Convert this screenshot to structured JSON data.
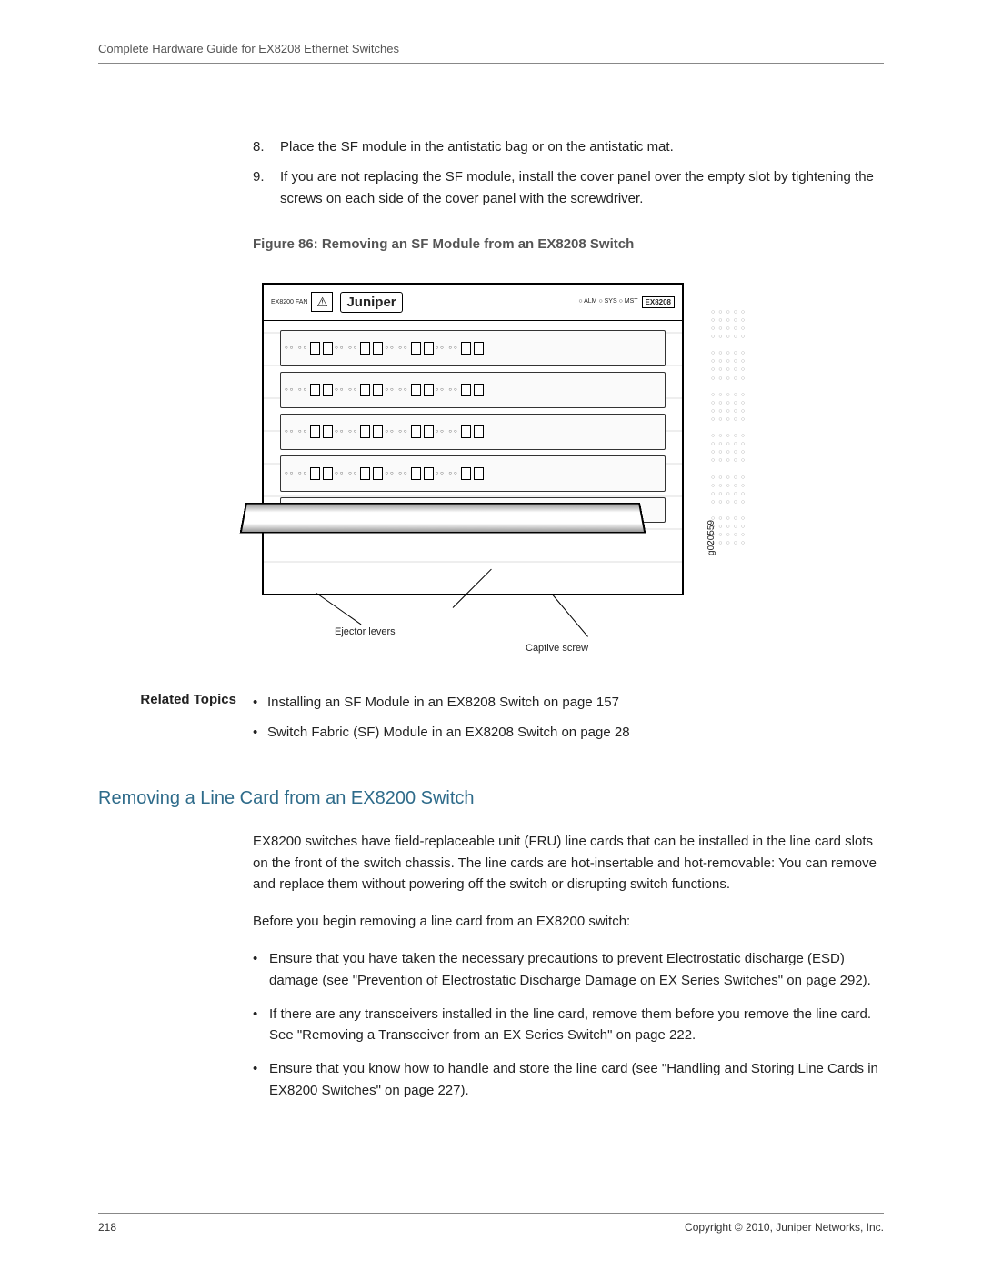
{
  "header": {
    "doc_title": "Complete Hardware Guide for EX8208 Ethernet Switches"
  },
  "steps": [
    {
      "num": "8.",
      "text": "Place the SF module in the antistatic bag or on the antistatic mat."
    },
    {
      "num": "9.",
      "text": "If you are not replacing the SF module, install the cover panel over the empty slot by tightening the screws on each side of the cover panel with the screwdriver."
    }
  ],
  "figure": {
    "caption": "Figure 86: Removing an SF Module from an EX8208 Switch",
    "brand": "Juniper",
    "fan_label": "EX8200 FAN",
    "leds": "○ ALM\n○ SYS\n○ MST",
    "model": "EX8208",
    "id": "g020559",
    "callout_ejector": "Ejector levers",
    "callout_screw": "Captive screw"
  },
  "related": {
    "label": "Related Topics",
    "items": [
      "Installing an SF Module in an EX8208 Switch on page 157",
      "Switch Fabric (SF) Module in an EX8208 Switch on page 28"
    ]
  },
  "section": {
    "title": "Removing a Line Card from an EX8200 Switch",
    "para1": "EX8200 switches have field-replaceable unit (FRU) line cards that can be installed in the line card slots on the front of the switch chassis. The line cards are hot-insertable and hot-removable: You can remove and replace them without powering off the switch or disrupting switch functions.",
    "para2": "Before you begin removing a line card from an EX8200 switch:",
    "bullets": [
      "Ensure that you have taken the necessary precautions to prevent Electrostatic discharge (ESD) damage (see \"Prevention of Electrostatic Discharge Damage on EX Series Switches\" on page 292).",
      "If there are any transceivers installed in the line card, remove them before you remove the line card. See \"Removing a Transceiver from an EX Series Switch\" on page 222.",
      "Ensure that you know how to handle and store the line card (see \"Handling and Storing Line Cards in EX8200 Switches\" on page 227)."
    ]
  },
  "footer": {
    "page": "218",
    "copyright": "Copyright © 2010, Juniper Networks, Inc."
  }
}
